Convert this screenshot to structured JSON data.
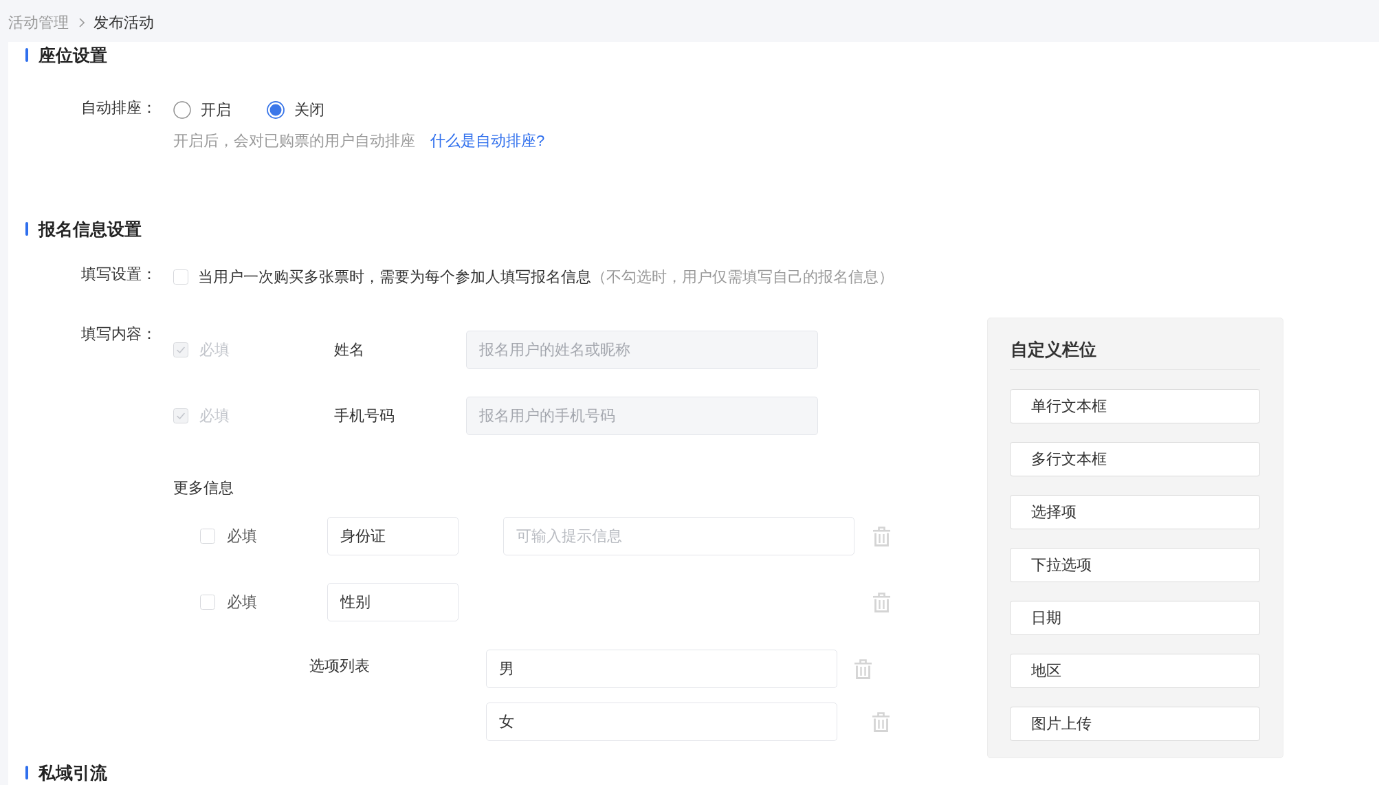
{
  "breadcrumb": [
    {
      "label": "活动管理",
      "current": false
    },
    {
      "label": "发布活动",
      "current": true
    }
  ],
  "seat_section": {
    "title": "座位设置",
    "auto_seating": {
      "label": "自动排座：",
      "options": [
        {
          "label": "开启",
          "selected": false
        },
        {
          "label": "关闭",
          "selected": true
        }
      ],
      "help": "开启后，会对已购票的用户自动排座",
      "link": "什么是自动排座?"
    }
  },
  "registration_section": {
    "title": "报名信息设置",
    "fill_setting": {
      "label": "填写设置：",
      "checked": false,
      "text": "当用户一次购买多张票时，需要为每个参加人填写报名信息",
      "note": "（不勾选时，用户仅需填写自己的报名信息）"
    },
    "fill_content": {
      "label": "填写内容：",
      "fixed_fields": [
        {
          "checked": true,
          "disabled": true,
          "required_label": "必填",
          "name": "姓名",
          "placeholder": "报名用户的姓名或昵称"
        },
        {
          "checked": true,
          "disabled": true,
          "required_label": "必填",
          "name": "手机号码",
          "placeholder": "报名用户的手机号码"
        }
      ],
      "more_info": {
        "title": "更多信息",
        "fields": [
          {
            "kind": "text",
            "checked": false,
            "required_label": "必填",
            "name": "身份证",
            "placeholder": "可输入提示信息"
          },
          {
            "kind": "choice",
            "checked": false,
            "required_label": "必填",
            "name": "性别",
            "options_label": "选项列表",
            "options": [
              "男",
              "女"
            ]
          }
        ]
      }
    }
  },
  "custom_fields_panel": {
    "title": "自定义栏位",
    "items": [
      "单行文本框",
      "多行文本框",
      "选择项",
      "下拉选项",
      "日期",
      "地区",
      "图片上传"
    ]
  },
  "traffic_section": {
    "title": "私域引流"
  }
}
